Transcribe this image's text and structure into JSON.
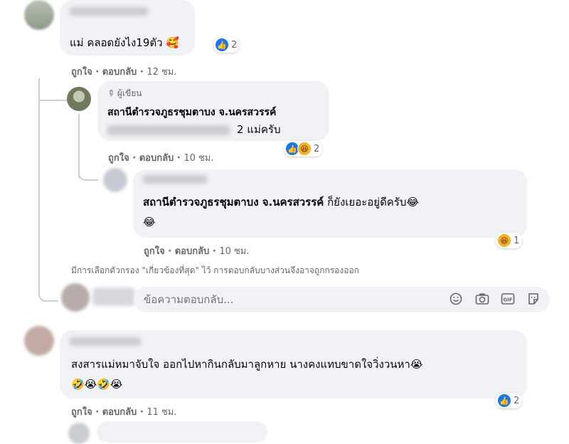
{
  "comments": [
    {
      "text": "แม่ คลอดยังไง19ตัว 🥰",
      "reaction_count": "2",
      "like_label": "ถูกใจ",
      "reply_label": "ตอบกลับ",
      "time": "12 ชม."
    },
    {
      "author_badge": "ผู้เขียน",
      "author": "สถานีตำรวจภูธรชุมตาบง จ.นครสวรรค์",
      "text_suffix": "2 แม่ครับ",
      "reaction_count": "2",
      "like_label": "ถูกใจ",
      "reply_label": "ตอบกลับ",
      "time": "10 ชม."
    },
    {
      "tagged": "สถานีตำรวจภูธรชุมตาบง จ.นครสวรรค์",
      "text": "ก็ยังเยอะอยู่ดีครับ😂",
      "text_line2": "😂",
      "reaction_count": "1",
      "like_label": "ถูกใจ",
      "reply_label": "ตอบกลับ",
      "time": "10 ชม."
    },
    {
      "text": "สงสารแม่หมาจับใจ ออกไปหากินกลับมาลูกหาย นางคงแทบขาดใจวิ่งวนหา😭",
      "text_line2": "🤣😭🤣😭",
      "reaction_count": "2",
      "like_label": "ถูกใจ",
      "reply_label": "ตอบกลับ",
      "time": "11 ชม."
    }
  ],
  "filter_note": "มีการเลือกตัวกรอง \"เกี่ยวข้องที่สุด\" ไว้ การตอบกลับบางส่วนจึงอาจถูกกรองออก",
  "reply_input": {
    "placeholder": "ข้อความตอบกลับ..."
  },
  "icons": [
    "smiley-icon",
    "camera-icon",
    "gif-icon",
    "sticker-icon",
    "pencil-icon",
    "like-reaction",
    "haha-reaction"
  ]
}
